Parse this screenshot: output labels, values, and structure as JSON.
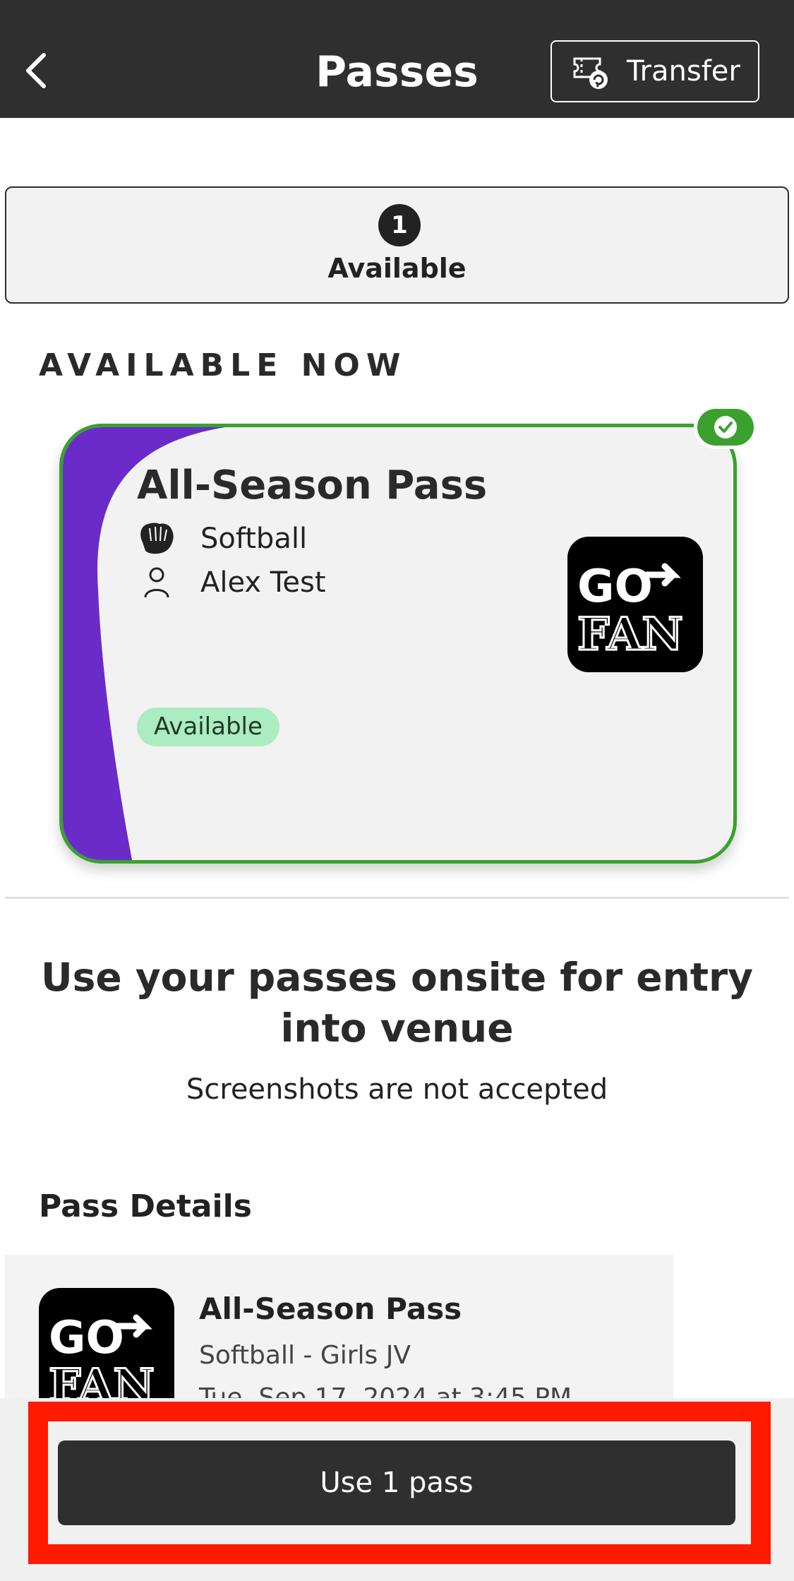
{
  "header": {
    "title": "Passes",
    "transfer_label": "Transfer"
  },
  "tabs": {
    "available_count": "1",
    "available_label": "Available"
  },
  "section_heading": "AVAILABLE NOW",
  "pass_card": {
    "title": "All-Season Pass",
    "sport": "Softball",
    "holder": "Alex Test",
    "status": "Available",
    "logo_name": "gofan-logo",
    "stripe_color": "#6a2bc8",
    "border_color": "#3aa12f"
  },
  "info": {
    "headline": "Use your passes onsite for entry into venue",
    "subtext": "Screenshots are not accepted"
  },
  "pass_details": {
    "heading": "Pass Details",
    "title": "All-Season Pass",
    "line1": "Softball - Girls JV",
    "line2": "Tue, Sep 17, 2024 at 3:45 PM"
  },
  "action": {
    "use_pass_label": "Use 1 pass",
    "highlight_color": "#ff1a00"
  }
}
